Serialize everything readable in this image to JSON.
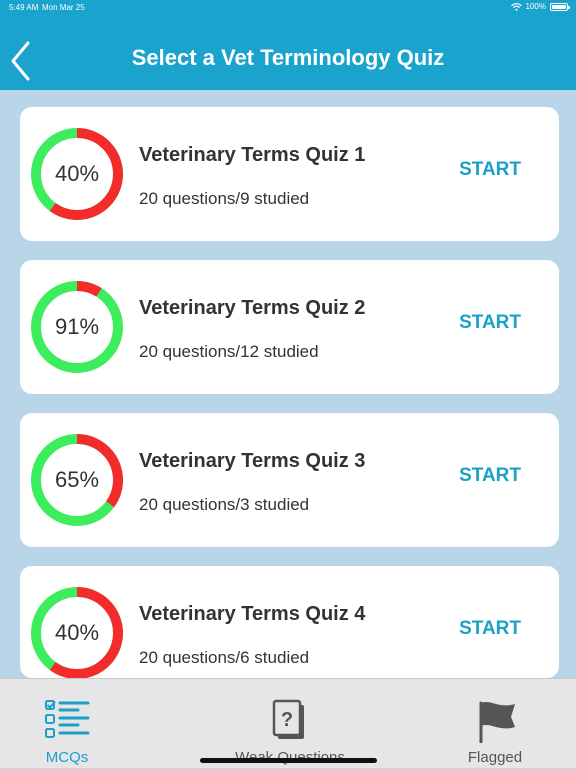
{
  "status_bar": {
    "time": "5:49 AM",
    "date": "Mon Mar 25",
    "battery": "100%"
  },
  "nav": {
    "title": "Select a Vet Terminology Quiz",
    "back_icon": "chevron-left-icon"
  },
  "colors": {
    "header": "#19a3cd",
    "accent": "#1ba0c8",
    "correct": "#3ded5e",
    "incorrect": "#f32b2b",
    "background": "#b9d6e8"
  },
  "quizzes": [
    {
      "title": "Veterinary Terms Quiz 1",
      "subtitle": "20 questions/9 studied",
      "percent_label": "40%",
      "percent": 40,
      "action": "START"
    },
    {
      "title": "Veterinary Terms Quiz 2",
      "subtitle": "20 questions/12 studied",
      "percent_label": "91%",
      "percent": 91,
      "action": "START"
    },
    {
      "title": "Veterinary Terms Quiz 3",
      "subtitle": "20 questions/3 studied",
      "percent_label": "65%",
      "percent": 65,
      "action": "START"
    },
    {
      "title": "Veterinary Terms Quiz 4",
      "subtitle": "20 questions/6 studied",
      "percent_label": "40%",
      "percent": 40,
      "action": "START"
    }
  ],
  "tabs": [
    {
      "label": "MCQs",
      "icon": "checklist-icon",
      "active": true
    },
    {
      "label": "Weak Questions",
      "icon": "question-cards-icon",
      "active": false
    },
    {
      "label": "Flagged",
      "icon": "flag-icon",
      "active": false
    }
  ]
}
